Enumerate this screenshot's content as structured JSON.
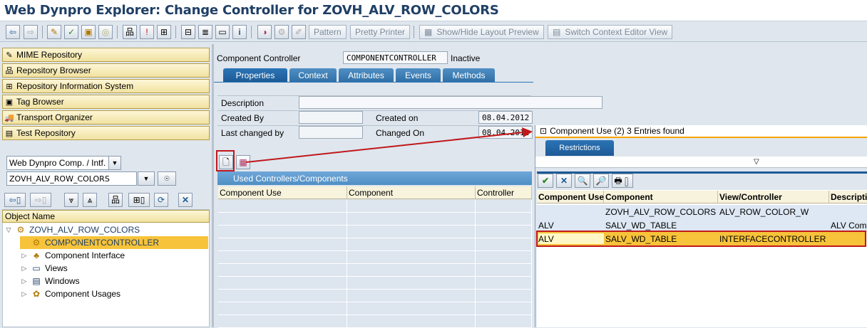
{
  "window": {
    "title": "Web Dynpro Explorer: Change Controller for ZOVH_ALV_ROW_COLORS"
  },
  "toolbar": {
    "pattern_label": "Pattern",
    "pretty_printer_label": "Pretty Printer",
    "show_hide_layout_label": "Show/Hide Layout Preview",
    "switch_context_label": "Switch Context Editor View"
  },
  "nav": {
    "items": [
      {
        "label": "MIME Repository",
        "icon": "mime-icon"
      },
      {
        "label": "Repository Browser",
        "icon": "repository-browser-icon"
      },
      {
        "label": "Repository Information System",
        "icon": "info-system-icon"
      },
      {
        "label": "Tag Browser",
        "icon": "tag-browser-icon"
      },
      {
        "label": "Transport Organizer",
        "icon": "transport-icon"
      },
      {
        "label": "Test Repository",
        "icon": "test-repository-icon"
      }
    ],
    "object_type_value": "Web Dynpro Comp. / Intf.",
    "object_name_value": "ZOVH_ALV_ROW_COLORS"
  },
  "tree": {
    "header": "Object Name",
    "root": "ZOVH_ALV_ROW_COLORS",
    "items": [
      {
        "label": "COMPONENTCONTROLLER",
        "selected": true
      },
      {
        "label": "Component Interface"
      },
      {
        "label": "Views"
      },
      {
        "label": "Windows"
      },
      {
        "label": "Component Usages"
      }
    ]
  },
  "header": {
    "component_controller_label": "Component Controller",
    "component_controller_value": "COMPONENTCONTROLLER",
    "status": "Inactive"
  },
  "tabs": [
    "Properties",
    "Context",
    "Attributes",
    "Events",
    "Methods"
  ],
  "properties": {
    "description_label": "Description",
    "description_value": "",
    "created_by_label": "Created By",
    "created_by_value": "",
    "created_on_label": "Created on",
    "created_on_value": "08.04.2012",
    "last_changed_by_label": "Last changed by",
    "last_changed_by_value": "",
    "changed_on_label": "Changed On",
    "changed_on_value": "08.04.2012"
  },
  "used_controllers": {
    "title": "Used Controllers/Components",
    "columns": [
      "Component Use",
      "Component",
      "Controller"
    ]
  },
  "popup": {
    "title": "Component Use (2)   3 Entries found",
    "restrictions_tab": "Restrictions",
    "columns": [
      "Component Use",
      "Component",
      "View/Controller",
      "Descripti"
    ],
    "rows": [
      {
        "use": "",
        "component": "ZOVH_ALV_ROW_COLORS",
        "controller": "ALV_ROW_COLOR_W",
        "description": ""
      },
      {
        "use": "ALV",
        "component": "SALV_WD_TABLE",
        "controller": "",
        "description": "ALV Com"
      },
      {
        "use": "ALV",
        "component": "SALV_WD_TABLE",
        "controller": "INTERFACECONTROLLER",
        "description": ""
      }
    ]
  },
  "colors": {
    "accent": "#2f6fa6",
    "highlight": "#f7c33a",
    "annotation": "#c0181a"
  }
}
